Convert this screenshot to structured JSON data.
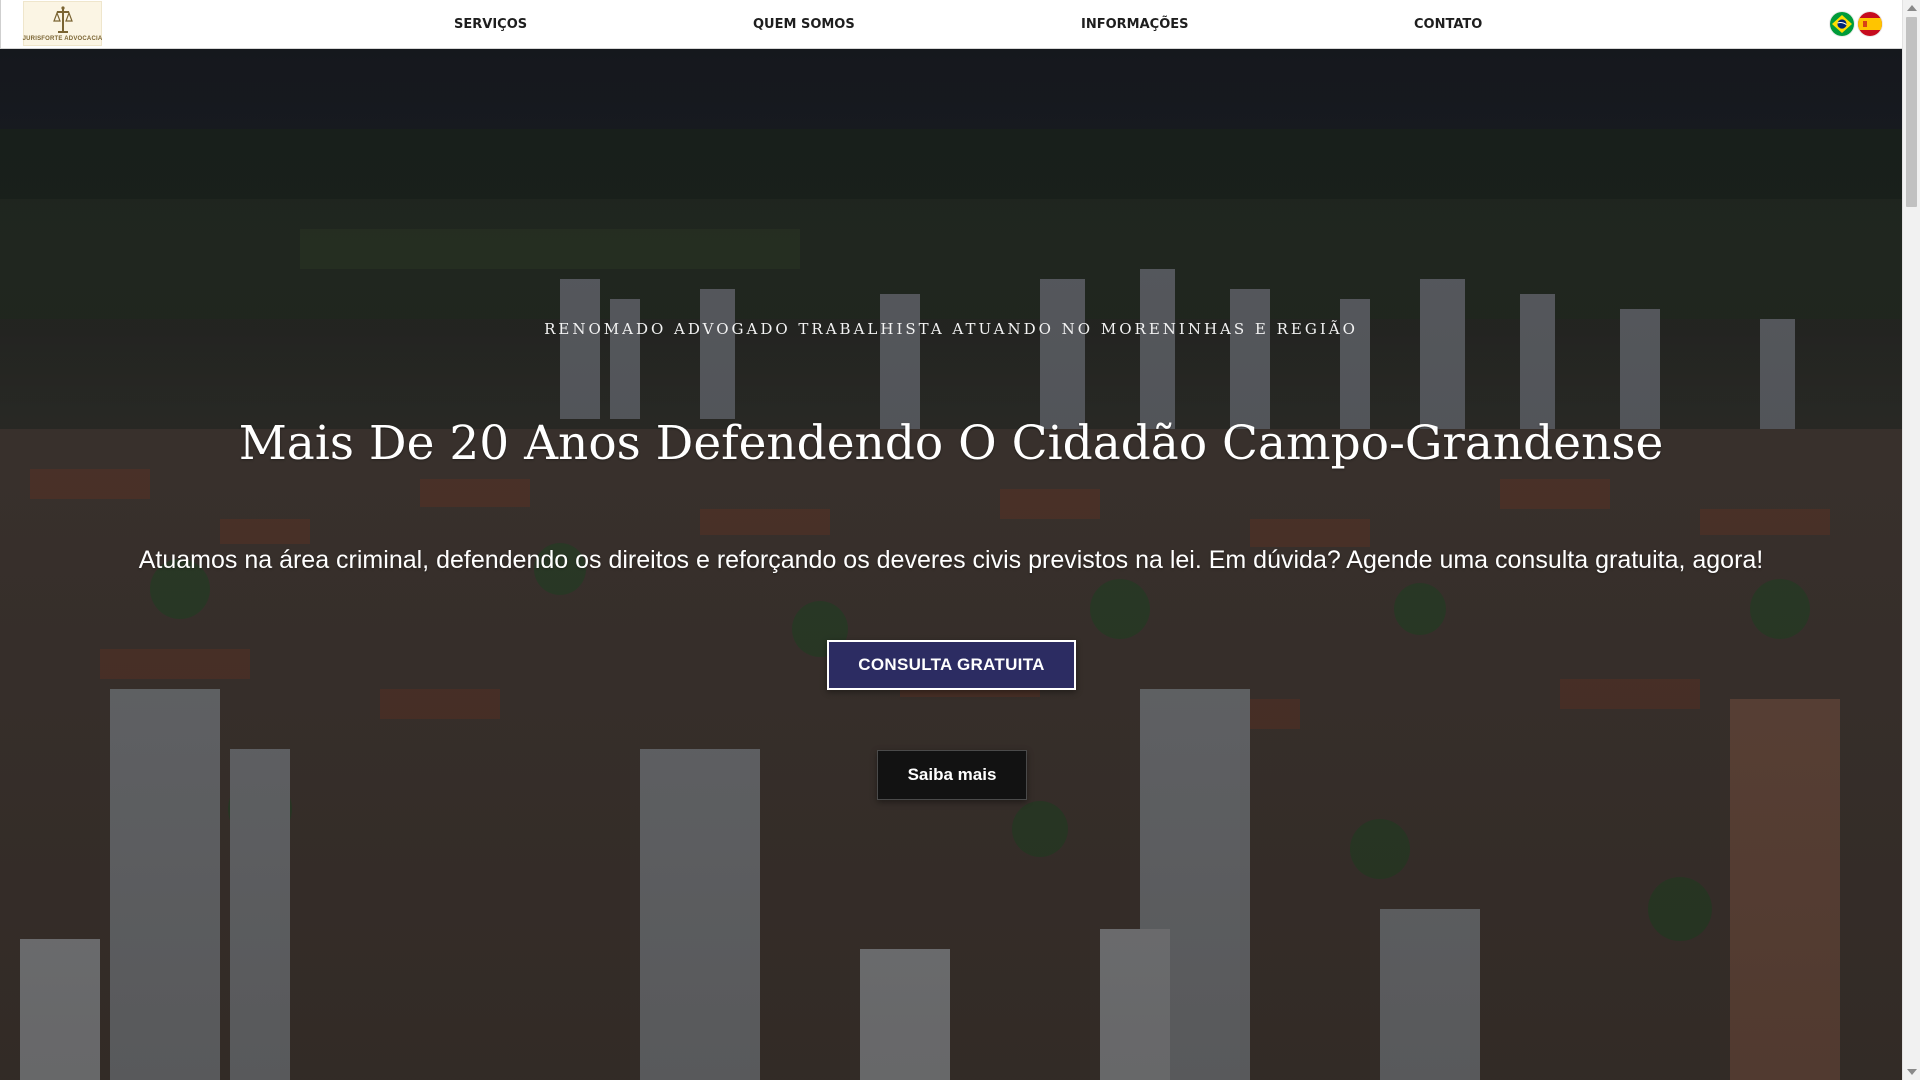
{
  "header": {
    "logo": {
      "text": "JURISFORTE ADVOCACIA"
    },
    "nav": [
      {
        "label": "SERVIÇOS"
      },
      {
        "label": "QUEM SOMOS"
      },
      {
        "label": "INFORMAÇÕES"
      },
      {
        "label": "CONTATO"
      }
    ],
    "languages": [
      {
        "name": "brazil-flag-icon"
      },
      {
        "name": "spain-flag-icon"
      }
    ]
  },
  "hero": {
    "kicker": "RENOMADO ADVOGADO TRABALHISTA ATUANDO NO MORENINHAS E REGIÃO",
    "headline": "Mais De 20 Anos Defendendo O Cidadão Campo-Grandense",
    "subtext": "Atuamos na área criminal, defendendo os direitos e reforçando os deveres civis previstos na lei. Em dúvida? Agende uma consulta gratuita, agora!",
    "primary_cta": "CONSULTA GRATUITA",
    "secondary_cta": "Saiba mais"
  },
  "colors": {
    "primary_button": "#2c2c62",
    "secondary_button": "#121212",
    "logo_gold": "#7a6432",
    "logo_background": "#fbf5e4"
  }
}
